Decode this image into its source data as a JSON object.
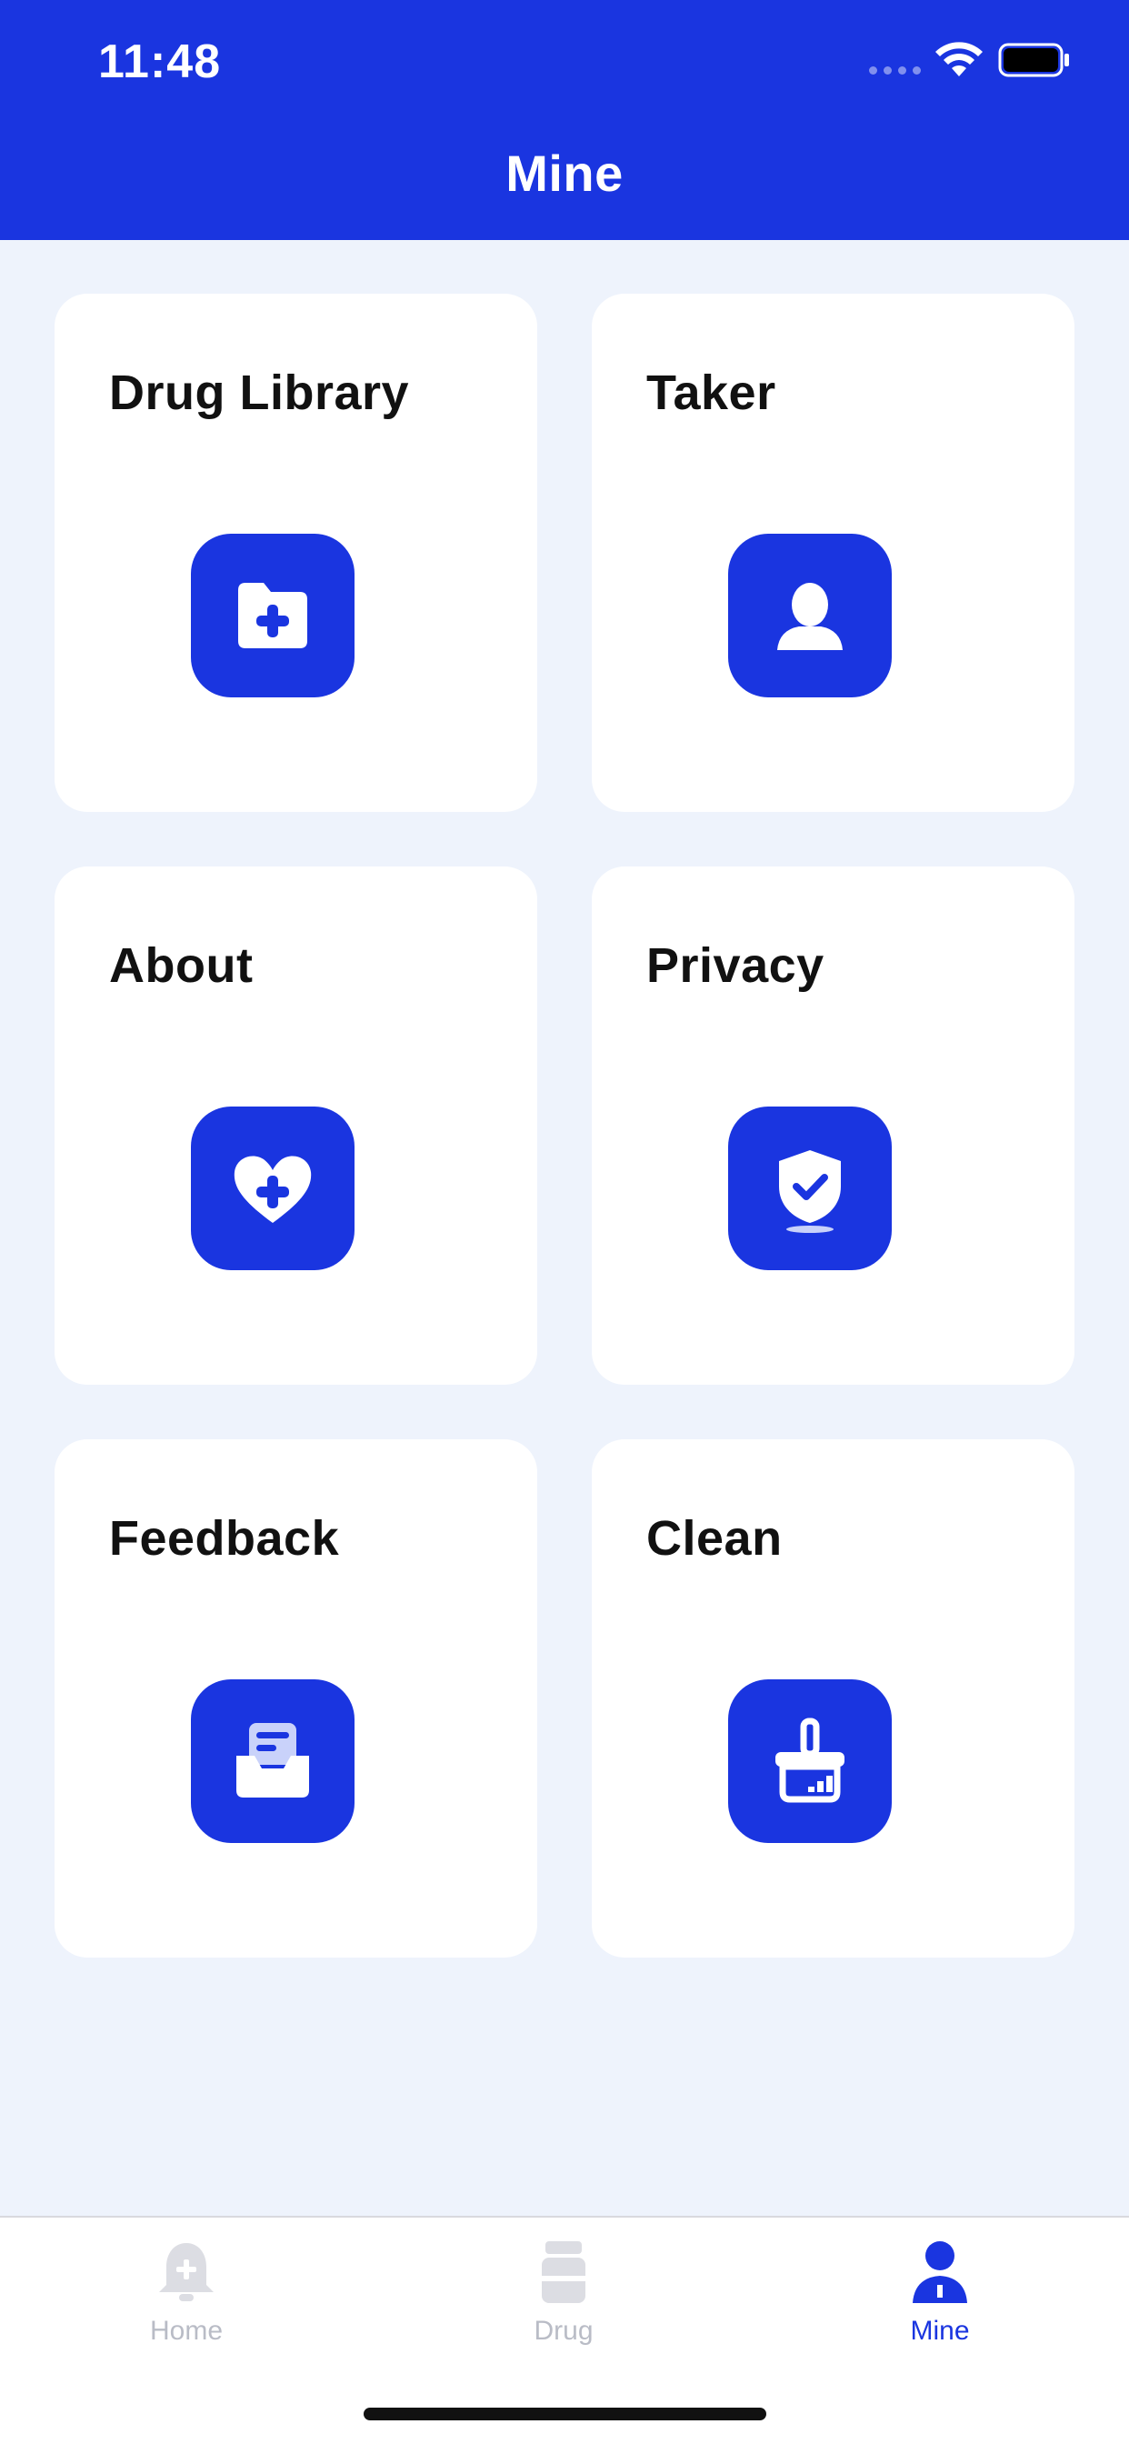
{
  "status_bar": {
    "time": "11:48"
  },
  "nav": {
    "title": "Mine"
  },
  "cards": [
    {
      "title": "Drug Library",
      "icon": "folder-plus-icon"
    },
    {
      "title": "Taker",
      "icon": "person-icon"
    },
    {
      "title": "About",
      "icon": "heart-plus-icon"
    },
    {
      "title": "Privacy",
      "icon": "shield-check-icon"
    },
    {
      "title": "Feedback",
      "icon": "inbox-letter-icon"
    },
    {
      "title": "Clean",
      "icon": "broom-icon"
    }
  ],
  "tabbar": {
    "items": [
      {
        "label": "Home",
        "icon": "bell-plus-icon",
        "active": false
      },
      {
        "label": "Drug",
        "icon": "pill-bottle-icon",
        "active": false
      },
      {
        "label": "Mine",
        "icon": "user-icon",
        "active": true
      }
    ]
  },
  "colors": {
    "brand": "#1A35E0",
    "background": "#EEF3FC",
    "card": "#FFFFFF",
    "tab_inactive": "#B9BCC6"
  }
}
